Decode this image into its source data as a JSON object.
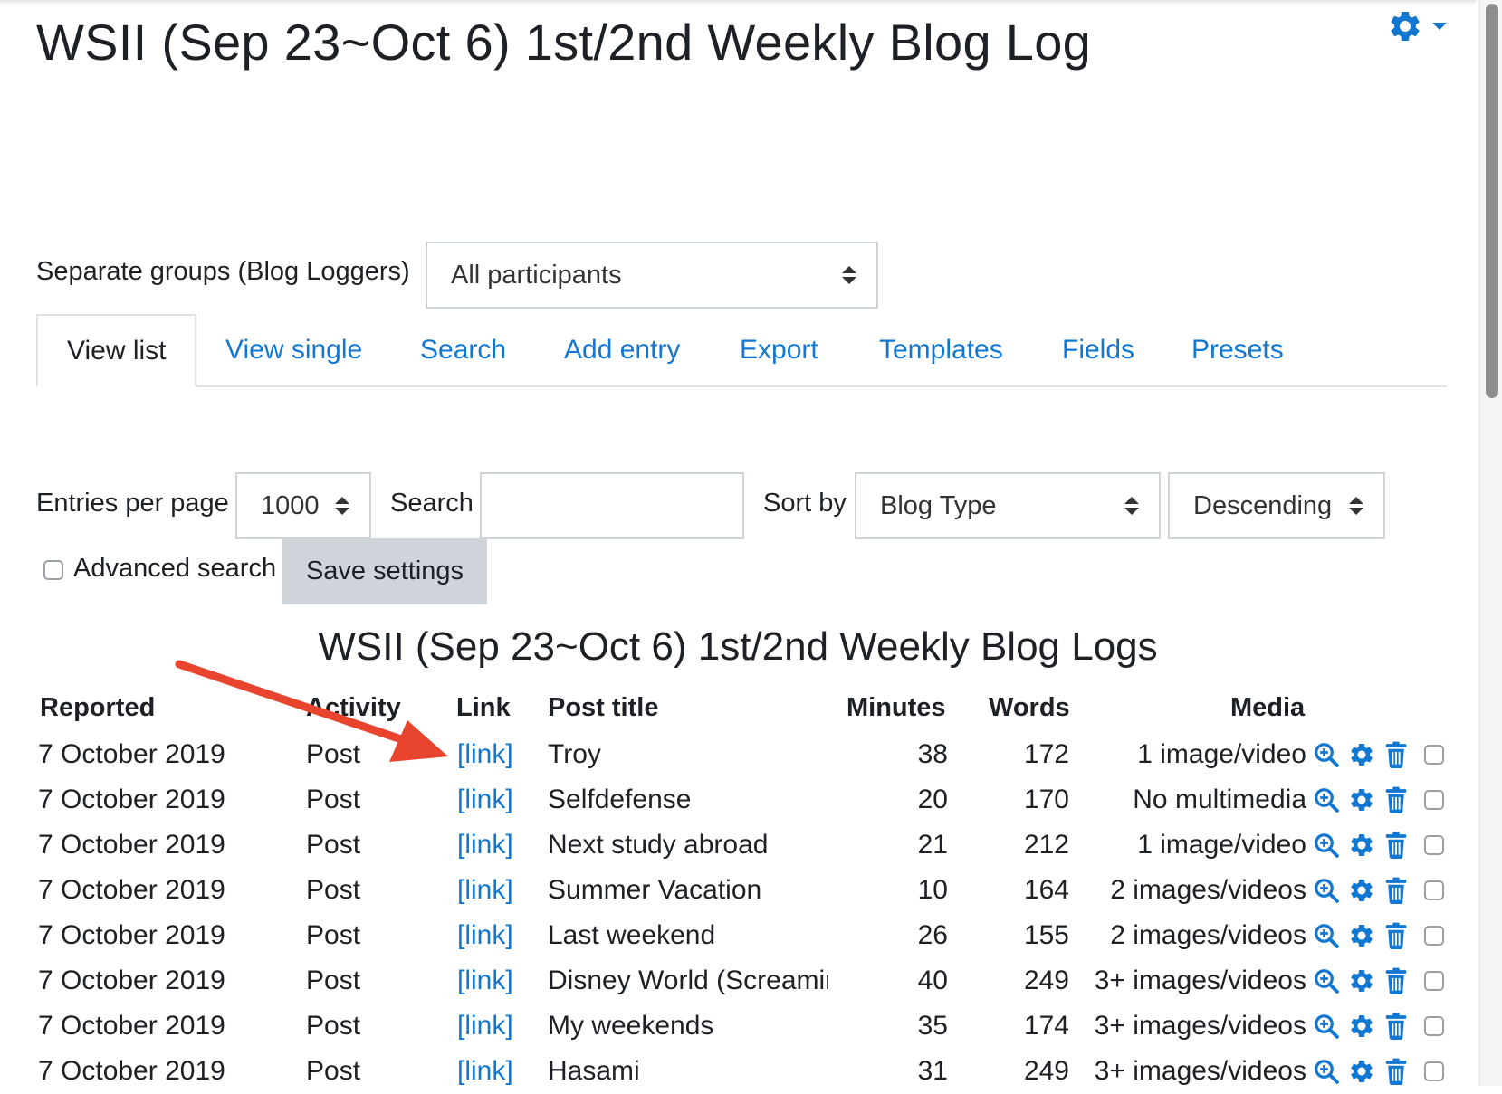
{
  "page": {
    "title": "WSII (Sep 23~Oct 6) 1st/2nd Weekly Blog Log"
  },
  "group_selector": {
    "label": "Separate groups (Blog Loggers)",
    "value": "All participants"
  },
  "tabs": [
    {
      "label": "View list",
      "active": true
    },
    {
      "label": "View single",
      "active": false
    },
    {
      "label": "Search",
      "active": false
    },
    {
      "label": "Add entry",
      "active": false
    },
    {
      "label": "Export",
      "active": false
    },
    {
      "label": "Templates",
      "active": false
    },
    {
      "label": "Fields",
      "active": false
    },
    {
      "label": "Presets",
      "active": false
    }
  ],
  "controls": {
    "entries_label": "Entries per page",
    "entries_value": "1000",
    "search_label": "Search",
    "search_value": "",
    "sortby_label": "Sort by",
    "sortby_value": "Blog Type",
    "order_value": "Descending",
    "advanced_label": "Advanced search",
    "save_label": "Save settings"
  },
  "table": {
    "title": "WSII (Sep 23~Oct 6) 1st/2nd Weekly Blog Logs",
    "headers": {
      "reported": "Reported",
      "activity": "Activity",
      "link": "Link",
      "post_title": "Post title",
      "minutes": "Minutes",
      "words": "Words",
      "media": "Media"
    },
    "rows": [
      {
        "reported": "7 October 2019",
        "activity": "Post",
        "link": "[link]",
        "title": "Troy",
        "minutes": "38",
        "words": "172",
        "media": "1 image/video"
      },
      {
        "reported": "7 October 2019",
        "activity": "Post",
        "link": "[link]",
        "title": "Selfdefense",
        "minutes": "20",
        "words": "170",
        "media": "No multimedia"
      },
      {
        "reported": "7 October 2019",
        "activity": "Post",
        "link": "[link]",
        "title": "Next study abroad",
        "minutes": "21",
        "words": "212",
        "media": "1 image/video"
      },
      {
        "reported": "7 October 2019",
        "activity": "Post",
        "link": "[link]",
        "title": "Summer Vacation",
        "minutes": "10",
        "words": "164",
        "media": "2 images/videos"
      },
      {
        "reported": "7 October 2019",
        "activity": "Post",
        "link": "[link]",
        "title": "Last weekend",
        "minutes": "26",
        "words": "155",
        "media": "2 images/videos"
      },
      {
        "reported": "7 October 2019",
        "activity": "Post",
        "link": "[link]",
        "title": "Disney World (Screamin",
        "minutes": "40",
        "words": "249",
        "media": "3+ images/videos"
      },
      {
        "reported": "7 October 2019",
        "activity": "Post",
        "link": "[link]",
        "title": "My weekends",
        "minutes": "35",
        "words": "174",
        "media": "3+ images/videos"
      },
      {
        "reported": "7 October 2019",
        "activity": "Post",
        "link": "[link]",
        "title": "Hasami",
        "minutes": "31",
        "words": "249",
        "media": "3+ images/videos"
      }
    ]
  },
  "colors": {
    "link": "#1177d1",
    "annotation_arrow": "#e8442e",
    "button_bg": "#ced4da"
  }
}
